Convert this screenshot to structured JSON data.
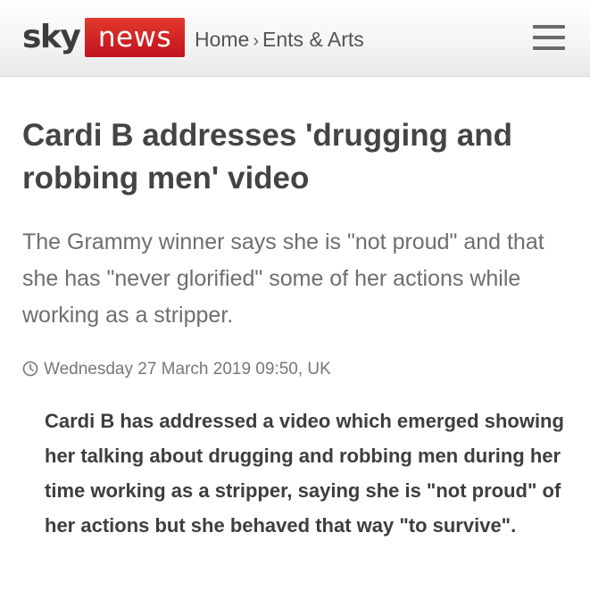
{
  "header": {
    "logo_sky": "sky",
    "logo_news": "news",
    "breadcrumb": {
      "home": "Home",
      "separator": "›",
      "section": "Ents & Arts"
    },
    "menu_icon": "hamburger-menu-icon"
  },
  "article": {
    "headline": "Cardi B addresses 'drugging and robbing men' video",
    "standfirst": "The Grammy winner says she is \"not proud\" and that she has \"never glorified\" some of her actions while working as a stripper.",
    "timestamp": "Wednesday 27 March 2019 09:50, UK",
    "timestamp_icon": "clock-icon",
    "lead": "Cardi B has addressed a video which emerged showing her talking about drugging and robbing men during her time working as a stripper, saying she is \"not proud\" of her actions but she behaved that way \"to survive\"."
  },
  "colors": {
    "brand_red": "#c0121f",
    "header_bg": "#f4f4f4",
    "headline_text": "#444444",
    "standfirst_text": "#6e6e6e"
  }
}
